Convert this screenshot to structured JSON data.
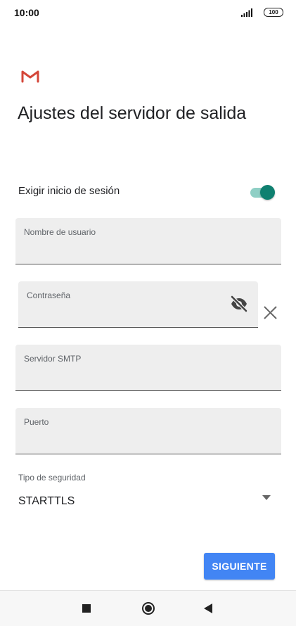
{
  "status_bar": {
    "time": "10:00",
    "battery": "100",
    "icons": [
      "signal-icon",
      "battery-icon"
    ]
  },
  "app": {
    "logo_icon": "gmail-icon",
    "brand_color": "#d44638"
  },
  "title": "Ajustes del servidor de salida",
  "login_required": {
    "label": "Exigir inicio de sesión",
    "enabled": true,
    "accent_color": "#0f8070"
  },
  "fields": {
    "username": {
      "label": "Nombre de usuario",
      "value": ""
    },
    "password": {
      "label": "Contraseña",
      "value": "",
      "toggle_icon": "visibility-off-icon",
      "clear_icon": "close-icon"
    },
    "smtp_server": {
      "label": "Servidor SMTP",
      "value": ""
    },
    "port": {
      "label": "Puerto",
      "value": ""
    }
  },
  "security": {
    "label": "Tipo de seguridad",
    "selected": "STARTTLS"
  },
  "actions": {
    "next_label": "SIGUIENTE",
    "next_color": "#4285f4"
  },
  "nav_bar": {
    "icons": [
      "recents-icon",
      "home-icon",
      "back-icon"
    ]
  }
}
